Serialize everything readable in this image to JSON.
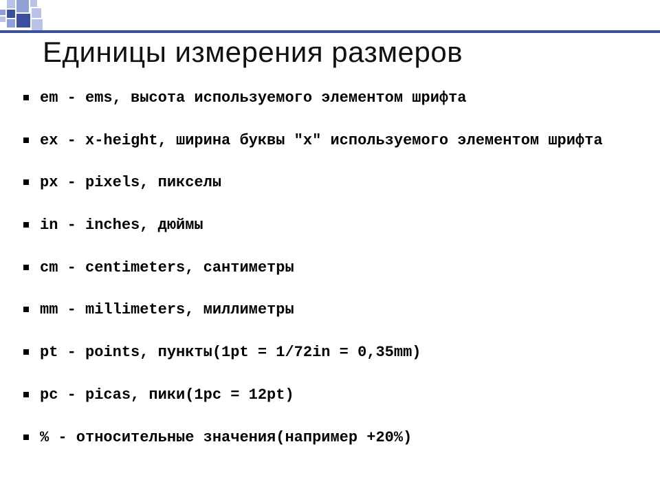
{
  "title": "Единицы измерения размеров",
  "items": [
    "em - ems, высота используемого элементом шрифта",
    "ex - x-height, ширина буквы \"х\" используемого элементом шрифта",
    "px - pixels, пикселы",
    "in - inches, дюймы",
    "cm - centimeters, сантиметры",
    "mm - millimeters, миллиметры",
    "pt - points, пункты(1pt = 1/72in = 0,35mm)",
    "pc - picas, пики(1pc = 12pt)",
    "% - относительные значения(например +20%)"
  ]
}
